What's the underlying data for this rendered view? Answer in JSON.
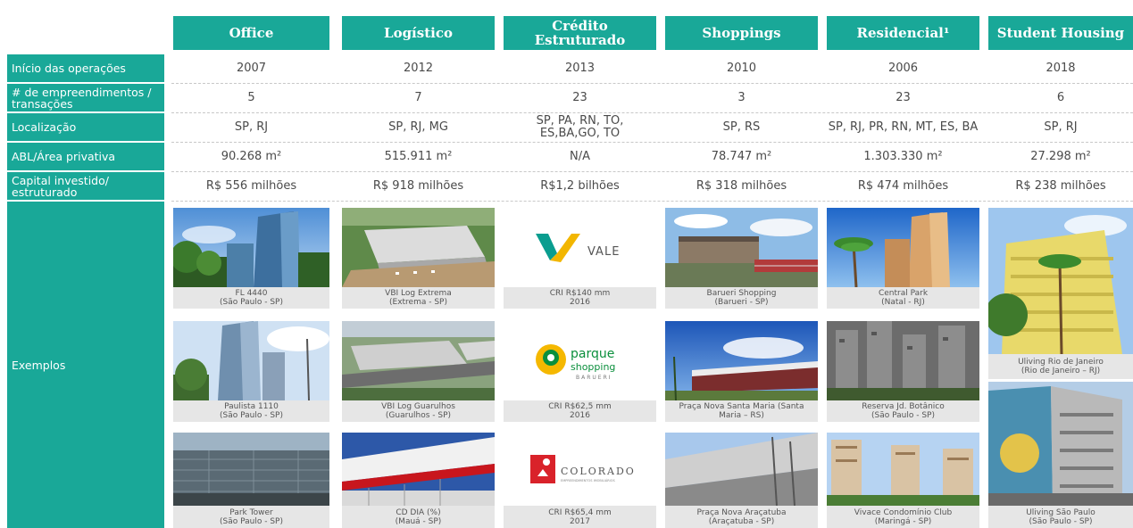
{
  "headers": [
    "Office",
    "Logístico",
    "Crédito Estruturado",
    "Shoppings",
    "Residencial¹",
    "Student Housing"
  ],
  "row_labels": [
    "Início das operações",
    "# de empreendimentos / transações",
    "Localização",
    "ABL/Área privativa",
    "Capital investido/ estruturado",
    "Exemplos"
  ],
  "rows": {
    "inicio": [
      "2007",
      "2012",
      "2013",
      "2010",
      "2006",
      "2018"
    ],
    "empreendimentos": [
      "5",
      "7",
      "23",
      "3",
      "23",
      "6"
    ],
    "localizacao": [
      "SP, RJ",
      "SP, RJ, MG",
      "SP, PA, RN, TO, ES,BA,GO, TO",
      "SP, RS",
      "SP, RJ, PR, RN, MT, ES, BA",
      "SP, RJ"
    ],
    "abl": [
      "90.268 m²",
      "515.911 m²",
      "N/A",
      "78.747 m²",
      "1.303.330 m²",
      "27.298 m²"
    ],
    "capital": [
      "R$ 556 milhões",
      "R$ 918 milhões",
      "R$1,2 bilhões",
      "R$ 318 milhões",
      "R$ 474 milhões",
      "R$ 238 milhões"
    ]
  },
  "examples": {
    "office": [
      {
        "line1": "FL 4440",
        "line2": "(São Paulo - SP)"
      },
      {
        "line1": "Paulista 1110",
        "line2": "(São Paulo - SP)"
      },
      {
        "line1": "Park Tower",
        "line2": "(São Paulo - SP)"
      }
    ],
    "logistico": [
      {
        "line1": "VBI Log Extrema",
        "line2": "(Extrema - SP)"
      },
      {
        "line1": "VBI Log Guarulhos",
        "line2": "(Guarulhos - SP)"
      },
      {
        "line1": "CD DIA (%)",
        "line2": "(Mauá - SP)"
      }
    ],
    "credito": [
      {
        "line1": "CRI R$140 mm",
        "line2": "2016"
      },
      {
        "line1": "CRI R$62,5 mm",
        "line2": "2016"
      },
      {
        "line1": "CRI R$65,4 mm",
        "line2": "2017"
      }
    ],
    "shoppings": [
      {
        "line1": "Barueri Shopping",
        "line2": "(Barueri - SP)"
      },
      {
        "line1": "Praça Nova Santa Maria (Santa",
        "line2": "Maria – RS)"
      },
      {
        "line1": "Praça Nova Araçatuba",
        "line2": "(Araçatuba - SP)"
      }
    ],
    "residencial": [
      {
        "line1": "Central Park",
        "line2": "(Natal - RJ)"
      },
      {
        "line1": "Reserva Jd. Botânico",
        "line2": "(São Paulo - SP)"
      },
      {
        "line1": "Vivace Condomínio Club",
        "line2": "(Maringá - SP)"
      }
    ],
    "student": [
      {
        "line1": "Uliving Rio de Janeiro",
        "line2": "(Rio de Janeiro – RJ)"
      },
      {
        "line1": "Uliving São Paulo",
        "line2": "(São Paulo - SP)"
      }
    ]
  },
  "logos": {
    "vale": "VALE",
    "parque_1": "parque",
    "parque_2": "shopping",
    "parque_3": "BARUERI",
    "colorado": "COLORADO",
    "colorado_sub": "EMPREENDIMENTOS IMOBILIÁRIOS"
  },
  "colors": {
    "teal": "#19a898",
    "caption_bg": "#e6e6e6"
  }
}
